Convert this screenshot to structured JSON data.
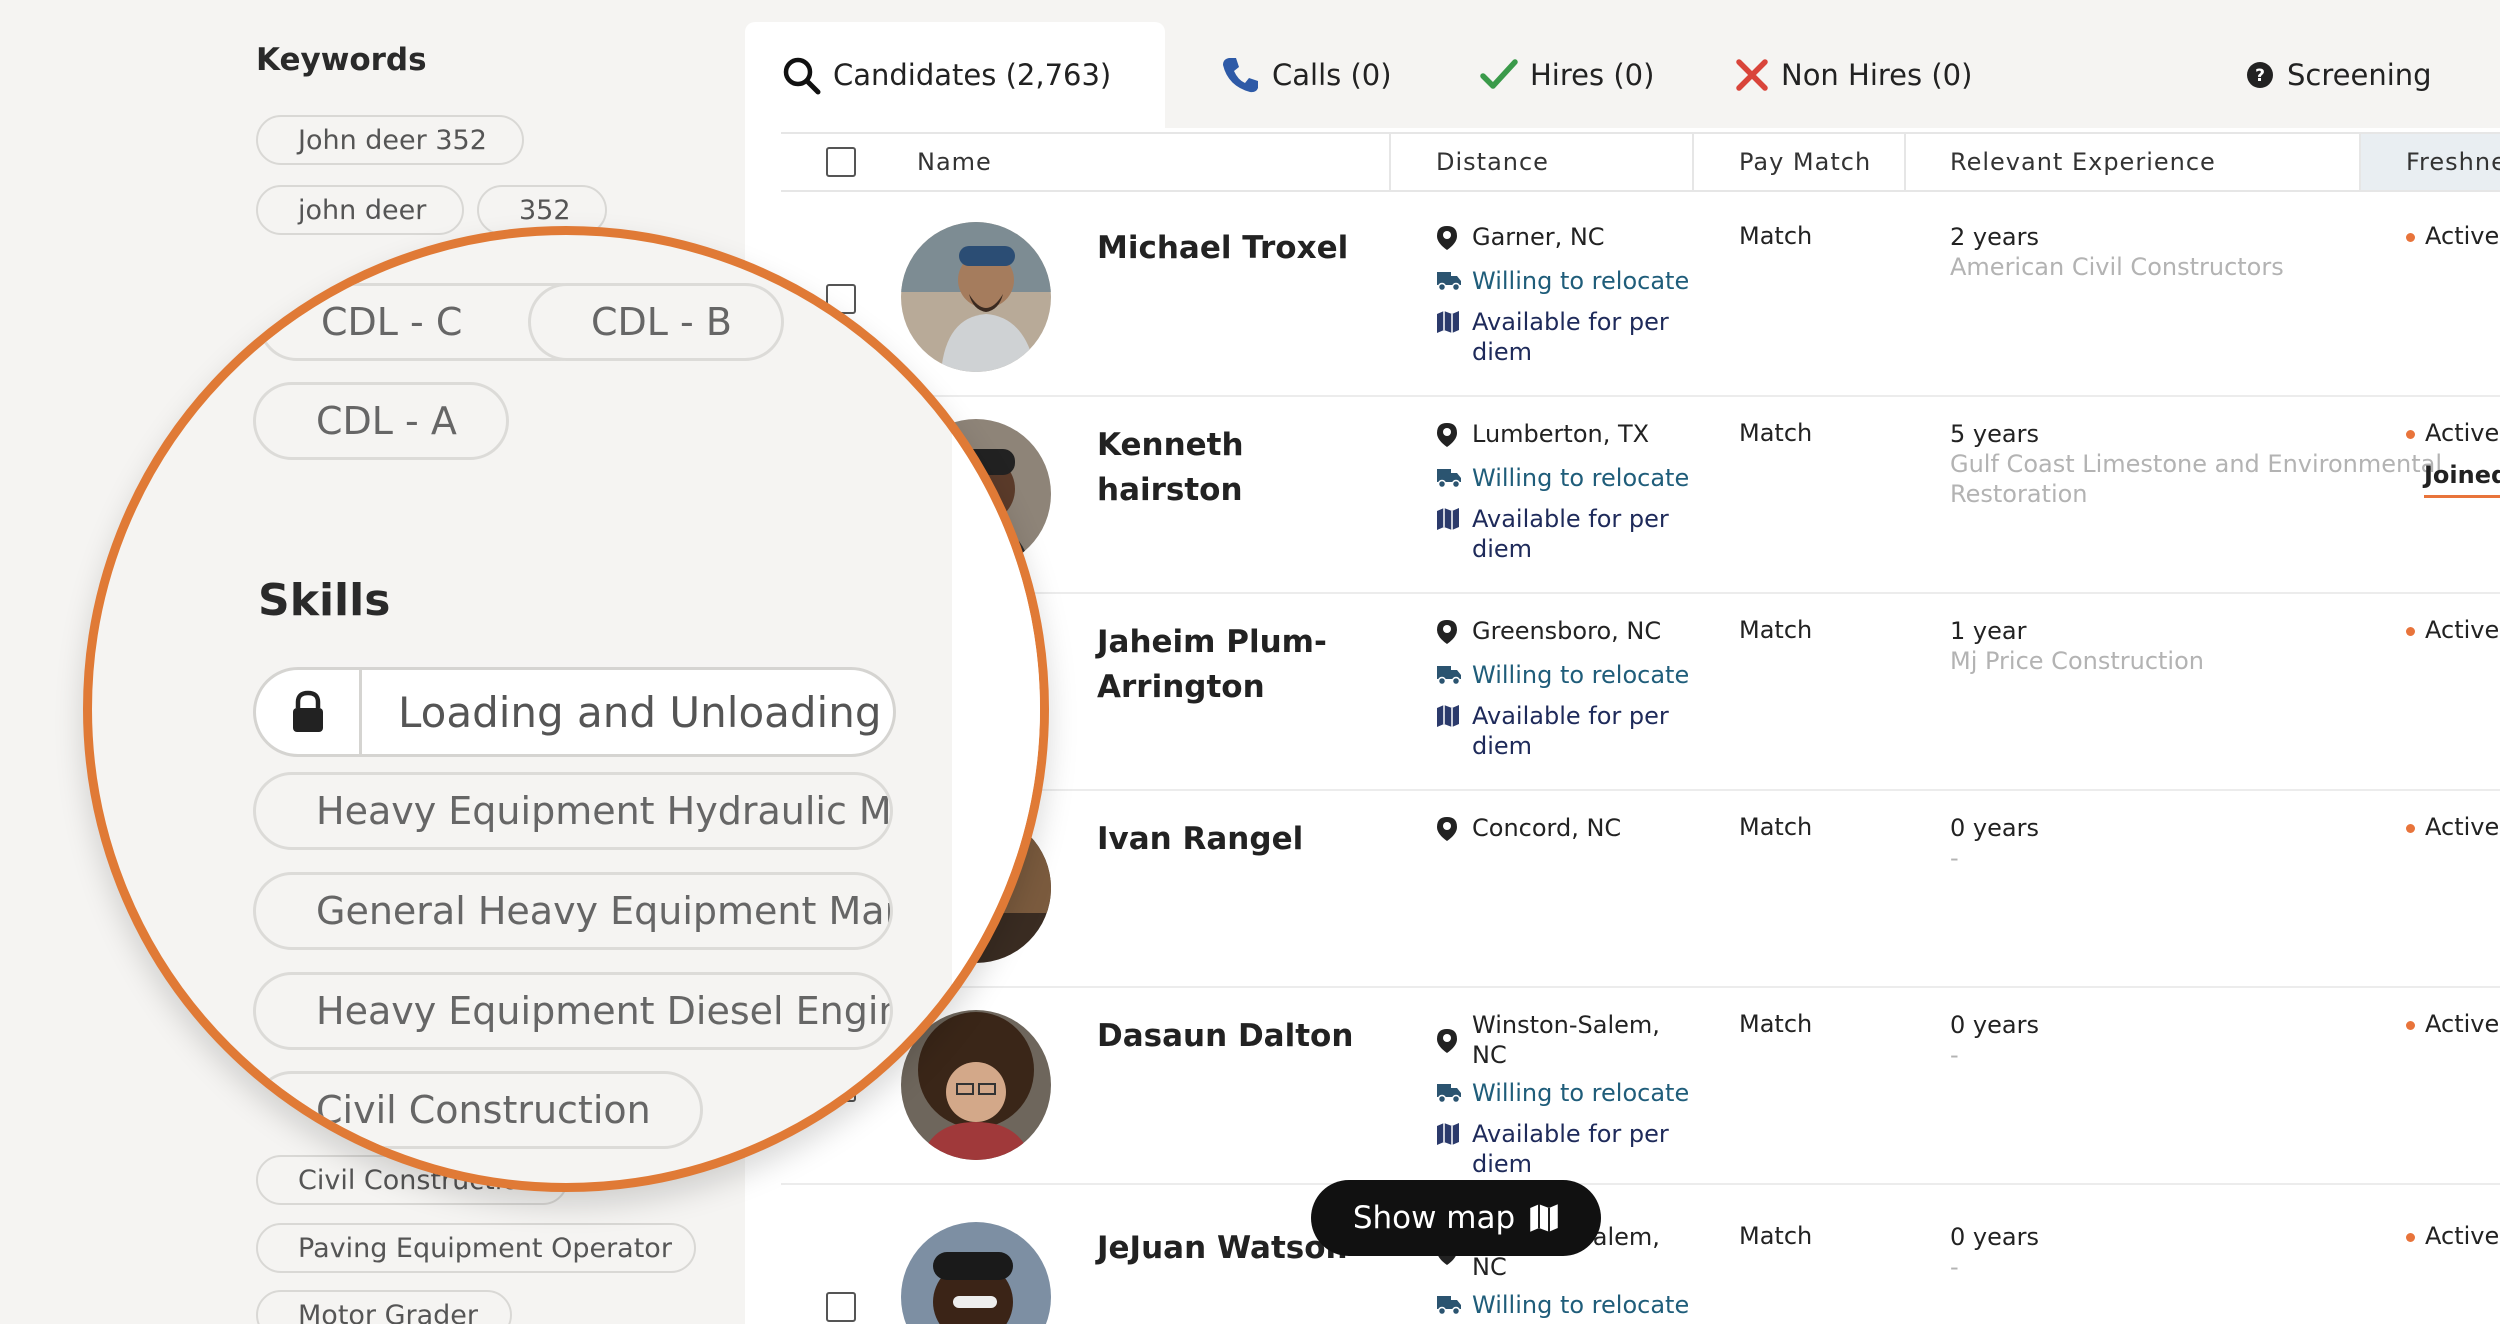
{
  "keywords": {
    "title": "Keywords",
    "chips": [
      "John deer 352",
      "john deer",
      "352"
    ]
  },
  "magnified": {
    "cdl_chips": [
      "CDL - C",
      "CDL - B",
      "CDL - A"
    ],
    "skills_title": "Skills",
    "locked_skill": "Loading and Unloading",
    "skills": [
      "Heavy Equipment Hydraulic M",
      "General Heavy Equipment Mai",
      "Heavy Equipment Diesel Engin",
      "Civil Construction"
    ]
  },
  "skills_below": [
    "Civil Construction",
    "Paving Equipment Operator",
    "Motor Grader"
  ],
  "tabs": [
    {
      "label": "Candidates (2,763)",
      "icon": "search-icon"
    },
    {
      "label": "Calls (0)",
      "icon": "phone-icon"
    },
    {
      "label": "Hires (0)",
      "icon": "check-icon"
    },
    {
      "label": "Non Hires (0)",
      "icon": "x-icon"
    },
    {
      "label": "Screening",
      "icon": "help-circle-icon"
    }
  ],
  "columns": [
    "Name",
    "Distance",
    "Pay Match",
    "Relevant Experience",
    "Freshne"
  ],
  "candidates": [
    {
      "name": "Michael Troxel",
      "location": "Garner, NC",
      "relocate": "Willing to relocate",
      "per_diem": "Available for per diem",
      "pay_match": "Match",
      "years": "2 years",
      "company": "American Civil Constructors",
      "freshness": "Active",
      "joined": ""
    },
    {
      "name": "Kenneth hairston",
      "location": "Lumberton, TX",
      "relocate": "Willing to relocate",
      "per_diem": "Available for per diem",
      "pay_match": "Match",
      "years": "5 years",
      "company": "Gulf Coast Limestone and Environmental Restoration",
      "freshness": "Active",
      "joined": "Joined"
    },
    {
      "name": "Jaheim Plum-Arrington",
      "location": "Greensboro, NC",
      "relocate": "Willing to relocate",
      "per_diem": "Available for per diem",
      "pay_match": "Match",
      "years": "1 year",
      "company": "Mj Price Construction",
      "freshness": "Active",
      "joined": ""
    },
    {
      "name": "Ivan Rangel",
      "location": "Concord, NC",
      "relocate": "",
      "per_diem": "",
      "pay_match": "Match",
      "years": "0 years",
      "company": "-",
      "freshness": "Active",
      "joined": ""
    },
    {
      "name": "Dasaun Dalton",
      "location": "Winston-Salem, NC",
      "relocate": "Willing to relocate",
      "per_diem": "Available for per diem",
      "pay_match": "Match",
      "years": "0 years",
      "company": "-",
      "freshness": "Active",
      "joined": ""
    },
    {
      "name": "JeJuan Watson",
      "location": "Winston-Salem, NC",
      "relocate": "Willing to relocate",
      "per_diem": "",
      "pay_match": "Match",
      "years": "0 years",
      "company": "-",
      "freshness": "Active",
      "joined": ""
    }
  ],
  "show_map": {
    "label": "Show map"
  },
  "colors": {
    "accent": "#e07a36",
    "link_blue": "#1f5d7a",
    "navy": "#1e2a5a",
    "active_dot": "#e8743b",
    "phone": "#2e5aa7",
    "check": "#3a9a4a",
    "x": "#d9443a"
  }
}
